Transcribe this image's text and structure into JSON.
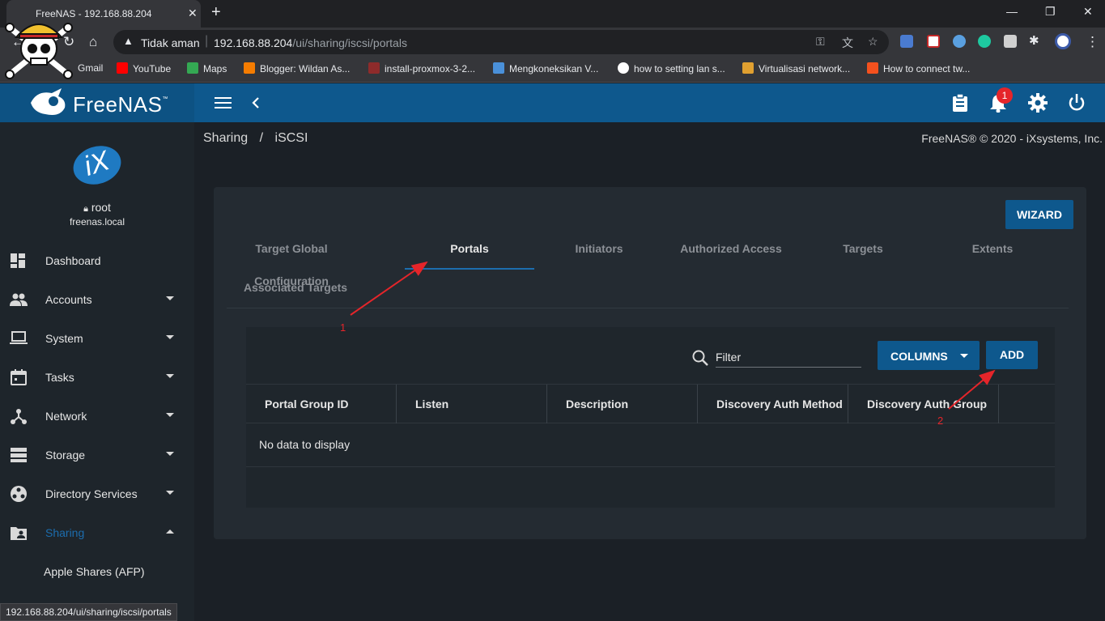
{
  "browser": {
    "tab_title": "FreeNAS - 192.168.88.204",
    "tab_close": "✕",
    "new_tab": "+",
    "security_label": "Tidak aman",
    "url_host": "192.168.88.204",
    "url_path": "/ui/sharing/iscsi/portals",
    "status_url": "192.168.88.204/ui/sharing/iscsi/portals"
  },
  "bookmarks": [
    {
      "label": "Gmail",
      "color": "#ea4335"
    },
    {
      "label": "YouTube",
      "color": "#ff0000"
    },
    {
      "label": "Maps",
      "color": "#34a853"
    },
    {
      "label": "Blogger: Wildan As...",
      "color": "#f57c00"
    },
    {
      "label": "install-proxmox-3-2...",
      "color": "#8e2b2b"
    },
    {
      "label": "Mengkoneksikan V...",
      "color": "#4a90d9"
    },
    {
      "label": "how to setting lan s...",
      "color": "#ffffff"
    },
    {
      "label": "Virtualisasi network...",
      "color": "#e0a030"
    },
    {
      "label": "How to connect tw...",
      "color": "#f4511e"
    }
  ],
  "app": {
    "logo": "FreeNAS",
    "logo_tm": "™",
    "notification_count": "1",
    "accent": "#0e588d"
  },
  "sidebar": {
    "user": "root",
    "host": "freenas.local",
    "items": [
      {
        "label": "Dashboard"
      },
      {
        "label": "Accounts"
      },
      {
        "label": "System"
      },
      {
        "label": "Tasks"
      },
      {
        "label": "Network"
      },
      {
        "label": "Storage"
      },
      {
        "label": "Directory Services"
      },
      {
        "label": "Sharing"
      }
    ],
    "sub_items": [
      {
        "label": "Apple Shares (AFP)"
      }
    ]
  },
  "header": {
    "breadcrumb_1": "Sharing",
    "breadcrumb_sep": "/",
    "breadcrumb_2": "iSCSI",
    "copyright": "FreeNAS® © 2020 - iXsystems, Inc."
  },
  "card": {
    "wizard_label": "WIZARD",
    "tabs": [
      {
        "label": "Target Global Configuration"
      },
      {
        "label": "Portals"
      },
      {
        "label": "Initiators"
      },
      {
        "label": "Authorized Access"
      },
      {
        "label": "Targets"
      },
      {
        "label": "Extents"
      },
      {
        "label": "Associated Targets"
      }
    ],
    "filter_placeholder": "Filter",
    "columns_label": "COLUMNS",
    "add_label": "ADD",
    "columns": [
      "Portal Group ID",
      "Listen",
      "Description",
      "Discovery Auth Method",
      "Discovery Auth Group"
    ],
    "empty_message": "No data to display"
  },
  "annotations": {
    "step1": "1",
    "step2": "2",
    "color": "#e5252a"
  }
}
